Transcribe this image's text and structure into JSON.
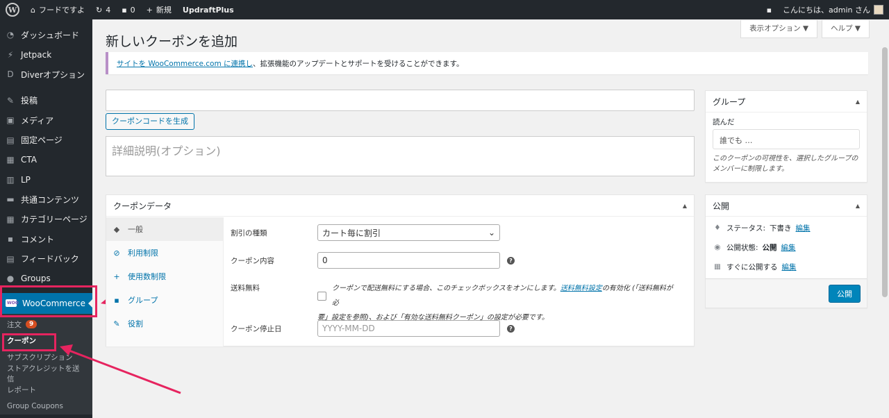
{
  "adminbar": {
    "site_name": "フードですよ",
    "updates": "4",
    "comments": "0",
    "new_label": "新規",
    "plugin": "UpdraftPlus",
    "greeting": "こんにちは、admin さん"
  },
  "sidebar": {
    "items": [
      {
        "label": "ダッシュボード",
        "icon": "dashboard-icon",
        "glyph": "◔"
      },
      {
        "label": "Jetpack",
        "icon": "jetpack-icon",
        "glyph": "⚡"
      },
      {
        "label": "Diverオプション",
        "icon": "diver-icon",
        "glyph": "D"
      },
      {
        "label": "投稿",
        "icon": "pin-icon",
        "glyph": "✎"
      },
      {
        "label": "メディア",
        "icon": "media-icon",
        "glyph": "▣"
      },
      {
        "label": "固定ページ",
        "icon": "pages-icon",
        "glyph": "▤"
      },
      {
        "label": "CTA",
        "icon": "cta-icon",
        "glyph": "▦"
      },
      {
        "label": "LP",
        "icon": "lp-icon",
        "glyph": "▥"
      },
      {
        "label": "共通コンテンツ",
        "icon": "folder-icon",
        "glyph": "▬"
      },
      {
        "label": "カテゴリーページ",
        "icon": "category-icon",
        "glyph": "▦"
      },
      {
        "label": "コメント",
        "icon": "comment-icon",
        "glyph": "▪"
      },
      {
        "label": "フィードバック",
        "icon": "feedback-icon",
        "glyph": "▤"
      },
      {
        "label": "Groups",
        "icon": "groups-icon",
        "glyph": "●"
      }
    ],
    "woocommerce": "WooCommerce",
    "submenu": [
      {
        "label": "注文",
        "badge": "9"
      },
      {
        "label": "クーポン"
      },
      {
        "label": "サブスクリプション"
      },
      {
        "label": "ストアクレジットを送信"
      },
      {
        "label": "レポート"
      },
      {
        "label": "Group Coupons"
      }
    ]
  },
  "screen_options": "表示オプション ▼",
  "help": "ヘルプ ▼",
  "page_title": "新しいクーポンを追加",
  "notice": {
    "link": "サイトを WooCommerce.com に連携し",
    "text": "、拡張機能のアップデートとサポートを受けることができます。"
  },
  "generate_code": "クーポンコードを生成",
  "description_placeholder": "詳細説明(オプション)",
  "coupon_data": {
    "title": "クーポンデータ",
    "tabs": [
      {
        "label": "一般",
        "glyph": "◆"
      },
      {
        "label": "利用制限",
        "glyph": "⊘"
      },
      {
        "label": "使用数制限",
        "glyph": "+"
      },
      {
        "label": "グループ",
        "glyph": "▪"
      },
      {
        "label": "役割",
        "glyph": "✎"
      }
    ],
    "discount_type_label": "割引の種類",
    "discount_type_value": "カート毎に割引",
    "amount_label": "クーポン内容",
    "amount_value": "0",
    "free_shipping_label": "送料無料",
    "free_shipping_text1": "クーポンで配送無料にする場合、このチェックボックスをオンにします。",
    "free_shipping_link": "送料無料設定",
    "free_shipping_text2": "の有効化 (「送料無料が必",
    "free_shipping_text3": "要」設定を参照)、および「有効な送料無料クーポン」の設定が必要です。",
    "expiry_label": "クーポン停止日",
    "expiry_placeholder": "YYYY-MM-DD"
  },
  "group_box": {
    "title": "グループ",
    "read_label": "読んだ",
    "placeholder": "誰でも …",
    "desc": "このクーポンの可視性を、選択したグループのメンバーに制限します。"
  },
  "publish_box": {
    "title": "公開",
    "status_label": "ステータス: ",
    "status_value": "下書き",
    "visibility_label": "公開状態: ",
    "visibility_value": "公開",
    "schedule_label": "すぐに公開する",
    "edit": "編集",
    "button": "公開"
  }
}
